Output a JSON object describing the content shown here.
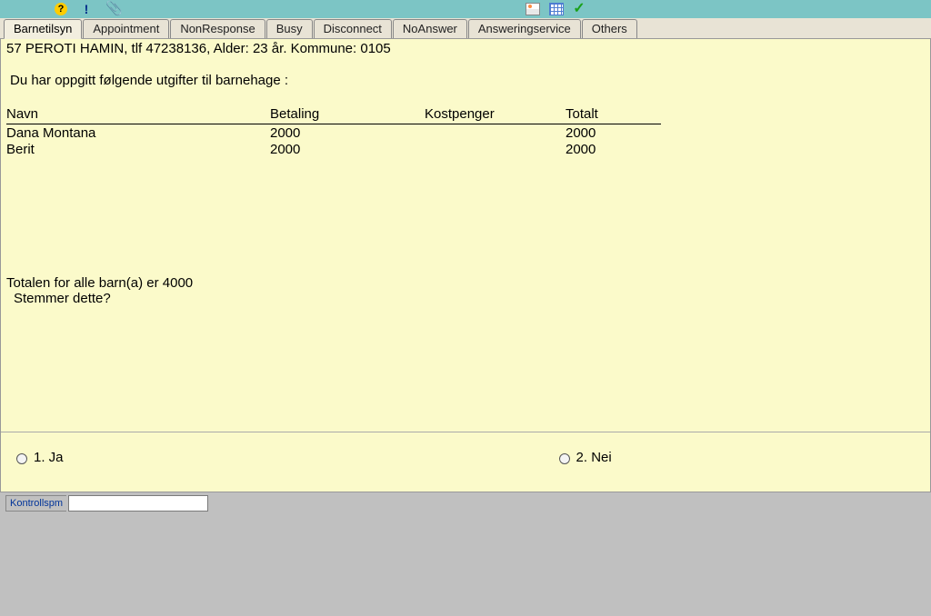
{
  "toolbar": {
    "help": "?",
    "exclaim": "!",
    "clip": "📎",
    "check": "✓"
  },
  "tabs": [
    {
      "label": "Barnetilsyn",
      "active": true
    },
    {
      "label": "Appointment"
    },
    {
      "label": "NonResponse"
    },
    {
      "label": "Busy"
    },
    {
      "label": "Disconnect"
    },
    {
      "label": "NoAnswer"
    },
    {
      "label": "Answeringservice"
    },
    {
      "label": "Others"
    }
  ],
  "question": {
    "header": "57 PEROTI HAMIN,  tlf 47238136, Alder:  23 år. Kommune: 0105",
    "intro": "Du har oppgitt følgende utgifter til barnehage :",
    "columns": {
      "navn": "Navn",
      "betaling": "Betaling",
      "kost": "Kostpenger",
      "totalt": "Totalt"
    },
    "rows": [
      {
        "navn": "Dana Montana",
        "betaling": "2000",
        "kost": "",
        "totalt": "2000"
      },
      {
        "navn": "Berit",
        "betaling": "2000",
        "kost": "",
        "totalt": "2000"
      }
    ],
    "total_line": "Totalen for alle barn(a) er 4000",
    "confirm": "Stemmer dette?"
  },
  "answers": {
    "opt1": "1. Ja",
    "opt2": "2. Nei"
  },
  "bottom": {
    "field_label": "Kontrollspm",
    "field_value": ""
  }
}
